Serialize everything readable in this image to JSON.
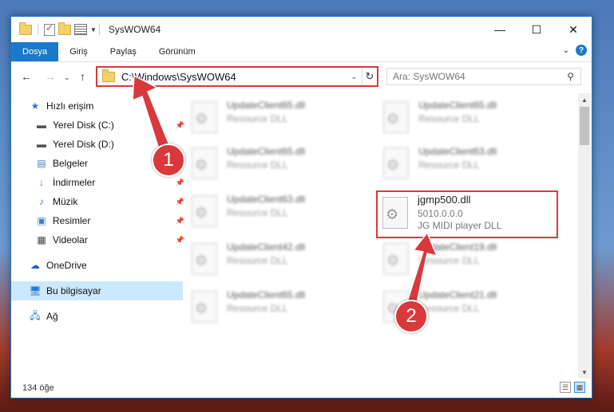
{
  "window": {
    "title": "SysWOW64",
    "buttons": {
      "minimize": "—",
      "maximize": "☐",
      "close": "✕"
    }
  },
  "ribbon": {
    "tabs": [
      "Dosya",
      "Giriş",
      "Paylaş",
      "Görünüm"
    ],
    "help": "?"
  },
  "address": {
    "path": "C:\\Windows\\SysWOW64",
    "search_placeholder": "Ara: SysWOW64"
  },
  "sidebar": {
    "items": [
      {
        "label": "Hızlı erişim",
        "icon": "star-icon"
      },
      {
        "label": "Yerel Disk (C:)",
        "icon": "drive-icon"
      },
      {
        "label": "Yerel Disk (D:)",
        "icon": "drive-icon"
      },
      {
        "label": "Belgeler",
        "icon": "documents-icon"
      },
      {
        "label": "İndirmeler",
        "icon": "download-icon"
      },
      {
        "label": "Müzik",
        "icon": "music-icon"
      },
      {
        "label": "Resimler",
        "icon": "pictures-icon"
      },
      {
        "label": "Videolar",
        "icon": "videos-icon"
      },
      {
        "label": "OneDrive",
        "icon": "cloud-icon"
      },
      {
        "label": "Bu bilgisayar",
        "icon": "computer-icon"
      },
      {
        "label": "Ağ",
        "icon": "network-icon"
      }
    ]
  },
  "files": [
    {
      "name": "UpdateClient65.dll",
      "type": "Resource DLL"
    },
    {
      "name": "UpdateClient65.dll",
      "type": "Resource DLL"
    },
    {
      "name": "UpdateClient65.dll",
      "type": "Resource DLL"
    },
    {
      "name": "UpdateClient63.dll",
      "type": "Resource DLL"
    },
    {
      "name": "UpdateClient63.dll",
      "type": "Resource DLL"
    },
    {
      "name": "jgmp500.dll",
      "version": "5010.0.0.0",
      "type": "JG MIDI player DLL"
    },
    {
      "name": "UpdateClient42.dll",
      "type": "Resource DLL"
    },
    {
      "name": "UpdateClient19.dll",
      "type": "Resource DLL"
    },
    {
      "name": "UpdateClient65.dll",
      "type": "Resource DLL"
    },
    {
      "name": "UpdateClient21.dll",
      "type": "Resource DLL"
    }
  ],
  "status": {
    "count": "134 öğe"
  },
  "callouts": {
    "one": "1",
    "two": "2"
  },
  "colors": {
    "accent": "#1979ca",
    "highlight": "#d9393b",
    "selected": "#cce8ff"
  }
}
